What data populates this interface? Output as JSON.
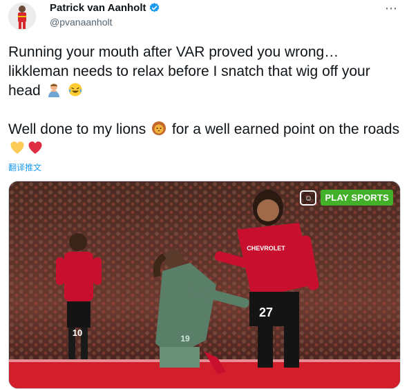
{
  "author": {
    "display_name": "Patrick van Aanholt",
    "handle": "@pvanaanholt",
    "verified": true
  },
  "more_icon": "⋯",
  "tweet": {
    "line1": "Running your mouth after VAR proved you wrong… likkleman needs to relax before I snatch that wig off your head",
    "line1_emojis": [
      "man-haircut-emoji",
      "crying-laughing-emoji"
    ],
    "line2": "Well done to my lions",
    "line2_emoji": "lion-emoji",
    "line2_rest": "for a well earned point on the roads",
    "line2_end_emojis": [
      "yellow-heart-emoji",
      "red-heart-emoji"
    ]
  },
  "translate_link": "翻译推文",
  "media": {
    "watermark_label": "PLAY SPORTS",
    "shirt_number_left": "10",
    "shirt_number_right": "27",
    "shirt_number_green": "19",
    "sponsor_text": "CHEVROLET"
  },
  "colors": {
    "link_blue": "#1d9bf0",
    "verified_blue": "#1d9bf0",
    "united_red": "#c8102e",
    "arsenal_green": "#5a7f69",
    "play_sports_green": "#43b02a"
  }
}
